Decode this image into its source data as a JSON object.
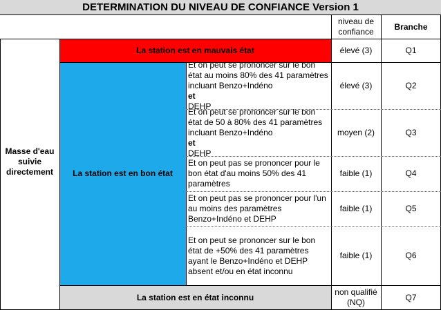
{
  "title": "DETERMINATION DU NIVEAU DE CONFIANCE Version 1",
  "headers": {
    "niveau": "niveau de confiance",
    "branche": "Branche"
  },
  "left_label": "Masse d'eau suivie directement",
  "states": {
    "mauvais": "La station est en mauvais état",
    "bon": "La station est en bon état",
    "inconnu": "La station est en état inconnu"
  },
  "rows": [
    {
      "desc": [],
      "niveau": "élevé (3)",
      "branche": "Q1"
    },
    {
      "desc": [
        "Et on peut se prononcer sur le bon état au moins 80% des 41 paramètres incluant Benzo+Indéno ",
        "et",
        " DEHP"
      ],
      "niveau": "élevé (3)",
      "branche": "Q2"
    },
    {
      "desc": [
        "Et on peut se prononcer sur le bon état de 50 à 80% des 41 paramètres incluant Benzo+Indéno ",
        "et",
        " DEHP"
      ],
      "niveau": "moyen (2)",
      "branche": "Q3"
    },
    {
      "desc": [
        "Et on peut pas se prononcer pour le bon état d'au moins 50% des 41 paramètres"
      ],
      "niveau": "faible (1)",
      "branche": "Q4"
    },
    {
      "desc": [
        "Et on peut pas se prononcer pour l'un au moins des paramètres Benzo+Indéno et DEHP"
      ],
      "niveau": "faible (1)",
      "branche": "Q5"
    },
    {
      "desc": [
        "Et on peut se prononcer sur le bon état de +50% des 41 paramètres ayant le Benzo+Indéno et DEHP absent et/ou en état inconnu"
      ],
      "niveau": "faible (1)",
      "branche": "Q6"
    },
    {
      "desc": [],
      "niveau": "non qualifié (NQ)",
      "branche": "Q7"
    }
  ],
  "colors": {
    "title_bg": "#d9d9d9",
    "bad_state": "#ff0000",
    "good_state": "#1eaaea",
    "unknown_state": "#d9d9d9"
  }
}
